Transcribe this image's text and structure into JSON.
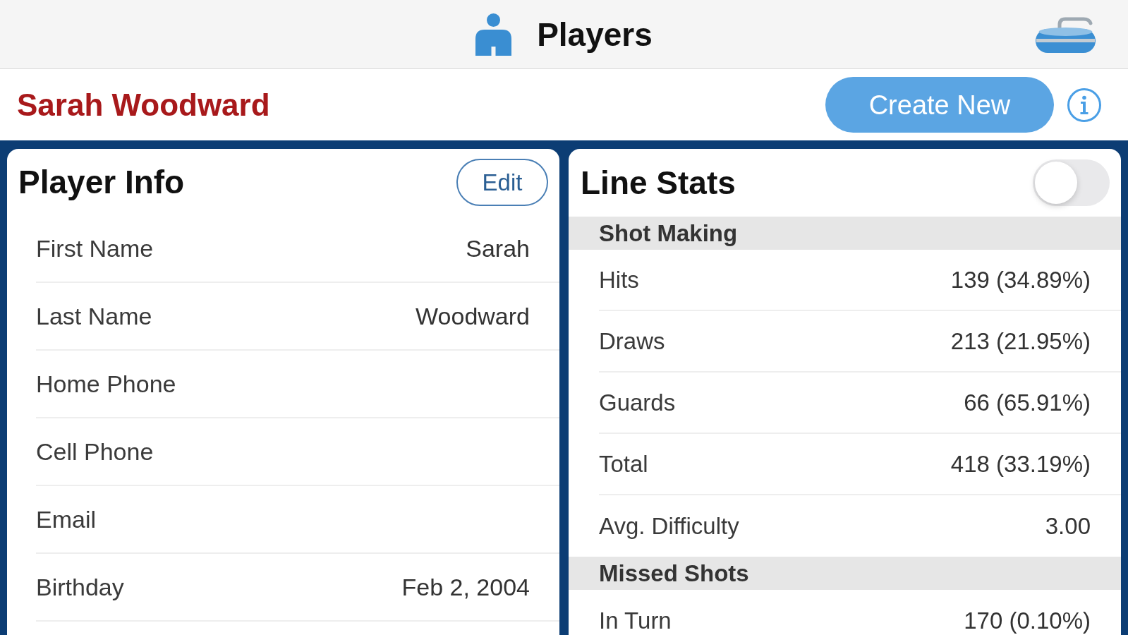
{
  "nav_bar": {
    "title": "Players"
  },
  "header": {
    "player_name": "Sarah Woodward",
    "create_button": "Create New"
  },
  "player_info": {
    "title": "Player Info",
    "edit_button": "Edit",
    "fields": [
      {
        "label": "First Name",
        "value": "Sarah"
      },
      {
        "label": "Last Name",
        "value": "Woodward"
      },
      {
        "label": "Home Phone"
      },
      {
        "label": "Cell Phone"
      },
      {
        "label": "Email"
      },
      {
        "label": "Birthday",
        "value": "Feb 2, 2004"
      }
    ]
  },
  "line_stats": {
    "title": "Line Stats",
    "toggle": {
      "on": false
    },
    "sections": [
      {
        "title": "Shot Making",
        "rows": [
          {
            "label": "Hits",
            "value": "139 (34.89%)"
          },
          {
            "label": "Draws",
            "value": "213 (21.95%)"
          },
          {
            "label": "Guards",
            "value": "66 (65.91%)"
          },
          {
            "label": "Total",
            "value": "418 (33.19%)"
          },
          {
            "label": "Avg. Difficulty",
            "value": "3.00"
          }
        ]
      },
      {
        "title": "Missed Shots",
        "rows": [
          {
            "label": "In Turn",
            "value": "170 (0.10%)"
          }
        ]
      }
    ]
  }
}
